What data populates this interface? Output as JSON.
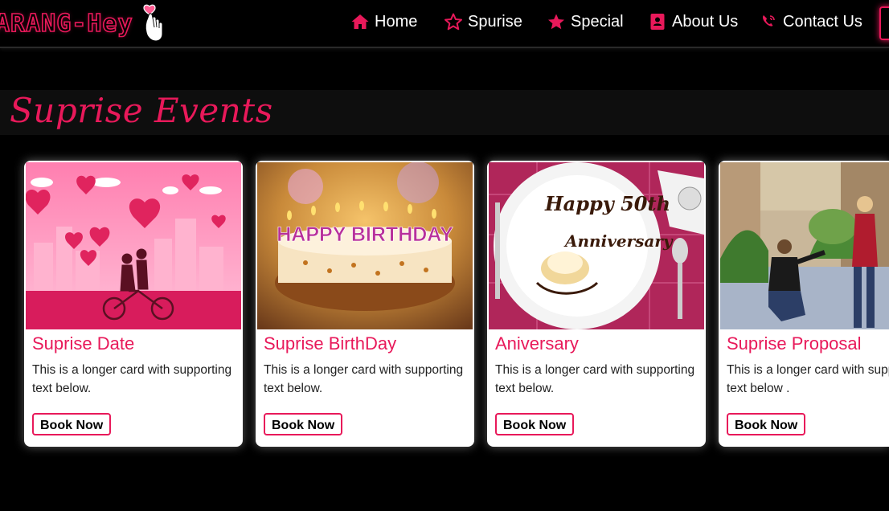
{
  "brand": {
    "name": "ARANG-Hey",
    "logo_icon": "finger-heart-icon"
  },
  "nav": {
    "items": [
      {
        "label": "Home",
        "icon": "home-icon"
      },
      {
        "label": "Spurise",
        "icon": "star-outline-icon"
      },
      {
        "label": "Special",
        "icon": "star-filled-icon"
      },
      {
        "label": "About Us",
        "icon": "contact-book-icon"
      },
      {
        "label": "Contact Us",
        "icon": "phone-icon"
      }
    ]
  },
  "section": {
    "title": "Suprise Events"
  },
  "cards": [
    {
      "title": "Suprise Date",
      "text": "This is a longer card with supporting text below.",
      "button": "Book Now"
    },
    {
      "title": "Suprise BirthDay",
      "text": "This is a longer card with supporting text below.",
      "button": "Book Now"
    },
    {
      "title": "Aniversary",
      "text": "This is a longer card with supporting text below.",
      "button": "Book Now"
    },
    {
      "title": "Suprise Proposal",
      "text": "This is a longer card with supporting text below .",
      "button": "Book Now"
    }
  ],
  "cake_candle_text": "HAPPY BIRTHDAY",
  "plate_text": [
    "Happy 50th",
    "Anniversary"
  ],
  "colors": {
    "accent": "#e8195a",
    "background": "#000000",
    "card": "#ffffff"
  }
}
